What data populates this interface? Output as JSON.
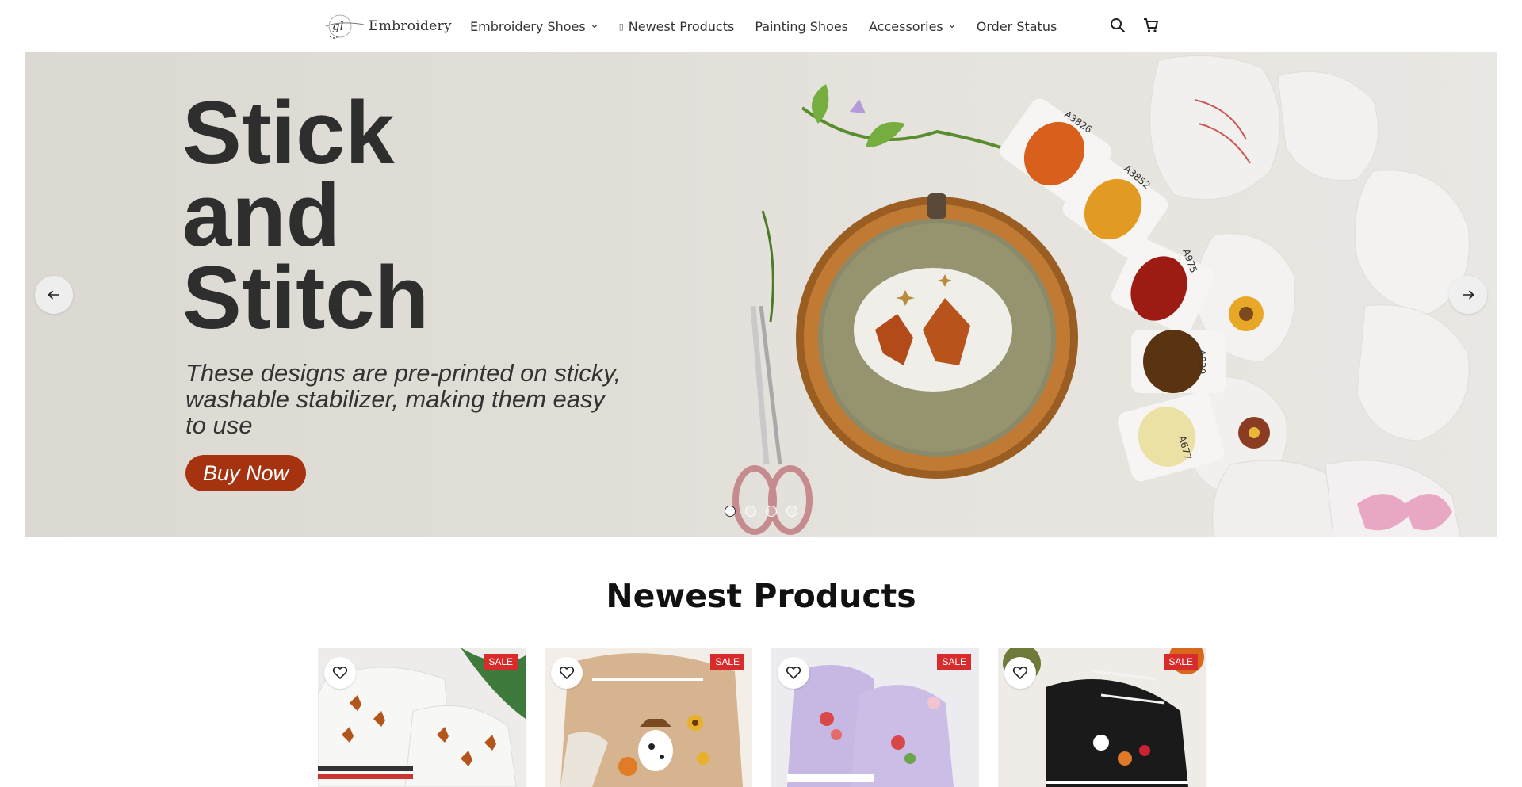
{
  "header": {
    "logo_mark": "gl",
    "logo_text": "Embroidery",
    "nav": [
      {
        "label": "Embroidery Shoes",
        "has_dropdown": true
      },
      {
        "label": "Newest Products",
        "glyph": "▯"
      },
      {
        "label": "Painting Shoes"
      },
      {
        "label": "Accessories",
        "has_dropdown": true
      },
      {
        "label": "Order Status"
      }
    ],
    "icons": [
      "search-icon",
      "cart-icon"
    ]
  },
  "hero": {
    "title": "Stick\nand\nStitch",
    "subtitle": "These designs are pre-printed on sticky, washable stabilizer, making them easy to use",
    "button_label": "Buy Now",
    "thread_labels": [
      "A3826",
      "A3852",
      "A975",
      "A830",
      "A677"
    ],
    "slides": 4,
    "active_slide": 1
  },
  "newest": {
    "title": "Newest Products",
    "products": [
      {
        "badge": "SALE"
      },
      {
        "badge": "SALE"
      },
      {
        "badge": "SALE"
      },
      {
        "badge": "SALE"
      }
    ]
  },
  "colors": {
    "accent_button": "#a6330f",
    "sale_badge": "#d82b2b"
  }
}
